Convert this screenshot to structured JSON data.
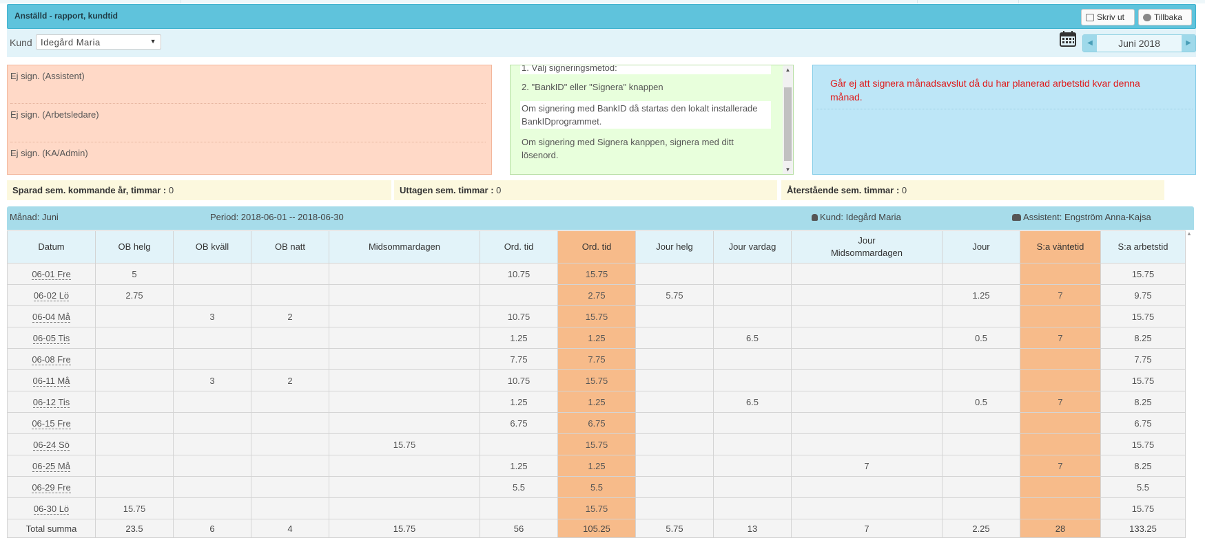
{
  "header": {
    "title": "Anställd - rapport, kundtid",
    "print_label": "Skriv ut",
    "back_label": "Tillbaka"
  },
  "customer": {
    "label": "Kund",
    "selected": "Idegård Maria"
  },
  "month_nav": {
    "label": "Juni 2018",
    "prev_icon": "triangle-left-icon",
    "next_icon": "triangle-right-icon"
  },
  "signatures": [
    "Ej sign. (Assistent)",
    "Ej sign. (Arbetsledare)",
    "Ej sign. (KA/Admin)"
  ],
  "instructions": [
    "1. Välj signeringsmetod:",
    "2. \"BankID\" eller \"Signera\" knappen",
    "Om signering med BankID då startas den lokalt installerade BankIDprogrammet.",
    "Om signering med Signera kanppen, signera med ditt lösenord."
  ],
  "message": "Går ej att signera månadsavslut då du har planerad arbetstid kvar denna månad.",
  "sem": {
    "saved_label": "Sparad sem. kommande år, timmar :",
    "saved_value": "0",
    "taken_label": "Uttagen sem. timmar :",
    "taken_value": "0",
    "remaining_label": "Återstående sem. timmar :",
    "remaining_value": "0"
  },
  "info": {
    "month": "Månad: Juni",
    "period": "Period: 2018-06-01 -- 2018-06-30",
    "customer": "Kund: Idegård Maria",
    "assistant": "Assistent: Engström Anna-Kajsa"
  },
  "table": {
    "headers": [
      "Datum",
      "OB helg",
      "OB kväll",
      "OB natt",
      "Midsommardagen",
      "Ord. tid",
      "Ord. tid",
      "Jour helg",
      "Jour vardag",
      "Jour Midsommardagen",
      "Jour",
      "S:a väntetid",
      "S:a arbetstid"
    ],
    "rows": [
      [
        "06-01 Fre",
        "5",
        "",
        "",
        "",
        "10.75",
        "15.75",
        "",
        "",
        "",
        "",
        "",
        "15.75"
      ],
      [
        "06-02 Lö",
        "2.75",
        "",
        "",
        "",
        "",
        "2.75",
        "5.75",
        "",
        "",
        "1.25",
        "7",
        "9.75"
      ],
      [
        "06-04 Må",
        "",
        "3",
        "2",
        "",
        "10.75",
        "15.75",
        "",
        "",
        "",
        "",
        "",
        "15.75"
      ],
      [
        "06-05 Tis",
        "",
        "",
        "",
        "",
        "1.25",
        "1.25",
        "",
        "6.5",
        "",
        "0.5",
        "7",
        "8.25"
      ],
      [
        "06-08 Fre",
        "",
        "",
        "",
        "",
        "7.75",
        "7.75",
        "",
        "",
        "",
        "",
        "",
        "7.75"
      ],
      [
        "06-11 Må",
        "",
        "3",
        "2",
        "",
        "10.75",
        "15.75",
        "",
        "",
        "",
        "",
        "",
        "15.75"
      ],
      [
        "06-12 Tis",
        "",
        "",
        "",
        "",
        "1.25",
        "1.25",
        "",
        "6.5",
        "",
        "0.5",
        "7",
        "8.25"
      ],
      [
        "06-15 Fre",
        "",
        "",
        "",
        "",
        "6.75",
        "6.75",
        "",
        "",
        "",
        "",
        "",
        "6.75"
      ],
      [
        "06-24 Sö",
        "",
        "",
        "",
        "15.75",
        "",
        "15.75",
        "",
        "",
        "",
        "",
        "",
        "15.75"
      ],
      [
        "06-25 Må",
        "",
        "",
        "",
        "",
        "1.25",
        "1.25",
        "",
        "",
        "7",
        "",
        "7",
        "8.25"
      ],
      [
        "06-29 Fre",
        "",
        "",
        "",
        "",
        "5.5",
        "5.5",
        "",
        "",
        "",
        "",
        "",
        "5.5"
      ],
      [
        "06-30 Lö",
        "15.75",
        "",
        "",
        "",
        "",
        "15.75",
        "",
        "",
        "",
        "",
        "",
        "15.75"
      ]
    ],
    "total": [
      "Total summa",
      "23.5",
      "6",
      "4",
      "15.75",
      "56",
      "105.25",
      "5.75",
      "13",
      "7",
      "2.25",
      "28",
      "133.25"
    ]
  },
  "colors": {
    "header_bg": "#5fc3dc",
    "highlight_col": "#f7bb8a",
    "sign_box_bg": "#ffd9c7",
    "instr_bg": "#e8ffdc",
    "msg_bg": "#bde6f7",
    "msg_text": "#e01b1b",
    "sem_bg": "#fcf8de"
  }
}
